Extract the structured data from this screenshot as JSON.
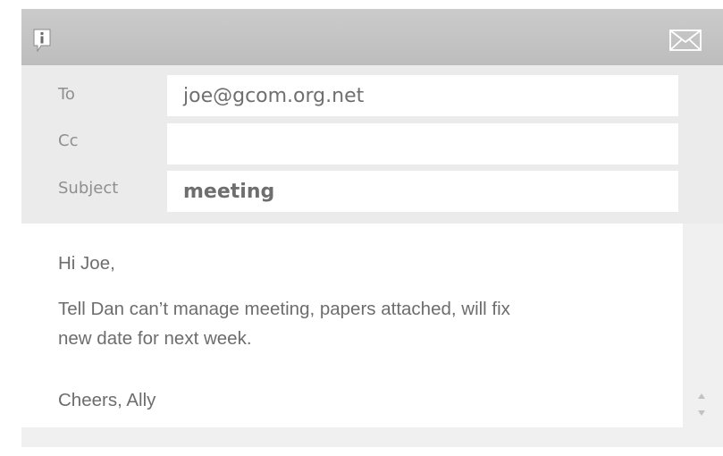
{
  "header": {
    "info_icon": "info-icon",
    "mail_icon": "envelope-icon"
  },
  "fields": {
    "to_label": "To",
    "to_value": "joe@gcom.org.net",
    "cc_label": "Cc",
    "cc_value": "",
    "subject_label": "Subject",
    "subject_value": "meeting"
  },
  "body": {
    "greeting": "Hi Joe,",
    "line1": "Tell Dan can’t manage meeting, papers attached, will fix",
    "line2": "new date for next week.",
    "signoff": "Cheers, Ally"
  },
  "colors": {
    "titlebar": "#c4c4c4",
    "background": "#f0f0f0",
    "field": "#ffffff",
    "text": "#6d6d6d"
  }
}
